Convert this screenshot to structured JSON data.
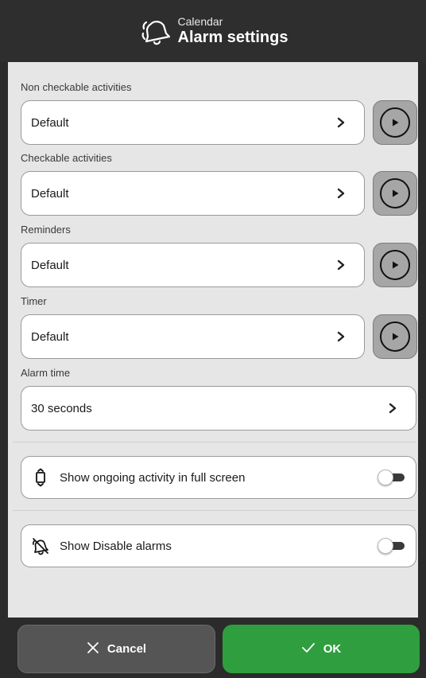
{
  "header": {
    "subtitle": "Calendar",
    "title": "Alarm settings",
    "icon": "bell-ringing-icon"
  },
  "sections": [
    {
      "label": "Non checkable activities",
      "value": "Default"
    },
    {
      "label": "Checkable activities",
      "value": "Default"
    },
    {
      "label": "Reminders",
      "value": "Default"
    },
    {
      "label": "Timer",
      "value": "Default"
    }
  ],
  "alarm_time": {
    "label": "Alarm time",
    "value": "30 seconds"
  },
  "toggles": [
    {
      "label": "Show ongoing activity in full screen",
      "icon": "fullscreen-activity-icon",
      "on": false
    },
    {
      "label": "Show Disable alarms",
      "icon": "bell-off-icon",
      "on": false
    }
  ],
  "footer": {
    "cancel_label": "Cancel",
    "ok_label": "OK"
  },
  "colors": {
    "header_bg": "#2e2e2e",
    "content_bg": "#e6e6e6",
    "ok_green": "#2f9e3e",
    "cancel_gray": "#555555",
    "play_bg": "#a6a6a6"
  }
}
